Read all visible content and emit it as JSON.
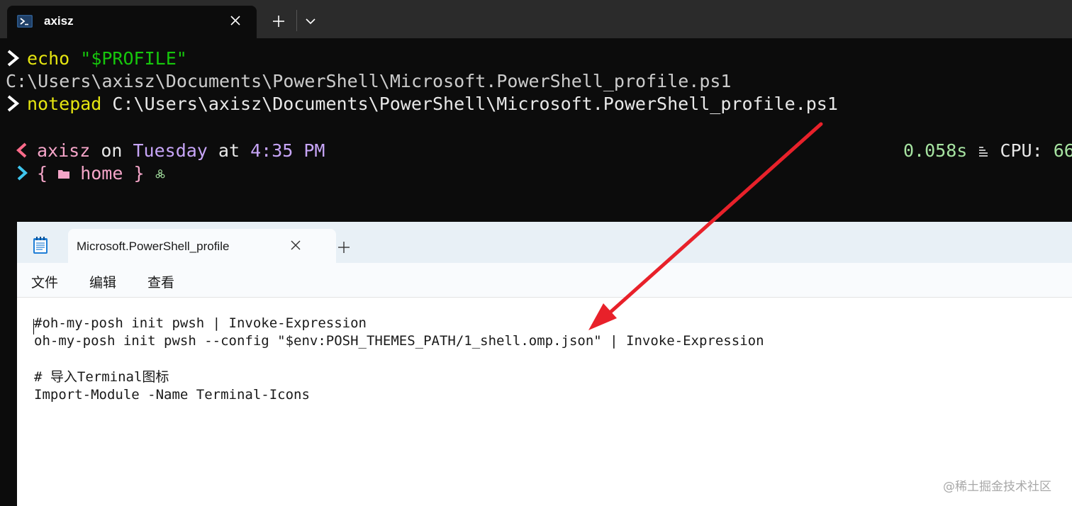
{
  "terminal": {
    "tab_title": "axisz",
    "lines": {
      "l1_cmd": "echo",
      "l1_arg": "\"$PROFILE\"",
      "l2_output": "C:\\Users\\axisz\\Documents\\PowerShell\\Microsoft.PowerShell_profile.ps1",
      "l3_cmd": "notepad",
      "l3_arg": "C:\\Users\\axisz\\Documents\\PowerShell\\Microsoft.PowerShell_profile.ps1"
    },
    "prompt": {
      "user": "axisz",
      "on": "on",
      "day": "Tuesday",
      "at": "at",
      "time": "4:35 PM",
      "open_brace": "{",
      "folder": "home",
      "close_brace": "}",
      "duration": "0.058s",
      "cpu_label": "CPU:",
      "cpu_value": "66"
    }
  },
  "notepad": {
    "tab_title": "Microsoft.PowerShell_profile",
    "menu": [
      "文件",
      "编辑",
      "查看"
    ],
    "code_lines": [
      "#oh-my-posh init pwsh | Invoke-Expression",
      "oh-my-posh init pwsh --config \"$env:POSH_THEMES_PATH/1_shell.omp.json\" | Invoke-Expression",
      "",
      "# 导入Terminal图标",
      "Import-Module -Name Terminal-Icons"
    ]
  },
  "watermark": "@稀土掘金技术社区",
  "colors": {
    "annotation_arrow": "#e8212a",
    "terminal_bg": "#0c0c0c",
    "prompt_pink": "#f5a5c8",
    "prompt_purple": "#c7a5f7",
    "prompt_cyan": "#3fc6ee"
  },
  "icons": [
    "powershell-icon",
    "close-icon",
    "plus-icon",
    "chevron-down-icon",
    "prompt-arrow-icon",
    "folder-icon",
    "biohazard-icon",
    "stack-icon",
    "notepad-icon"
  ]
}
